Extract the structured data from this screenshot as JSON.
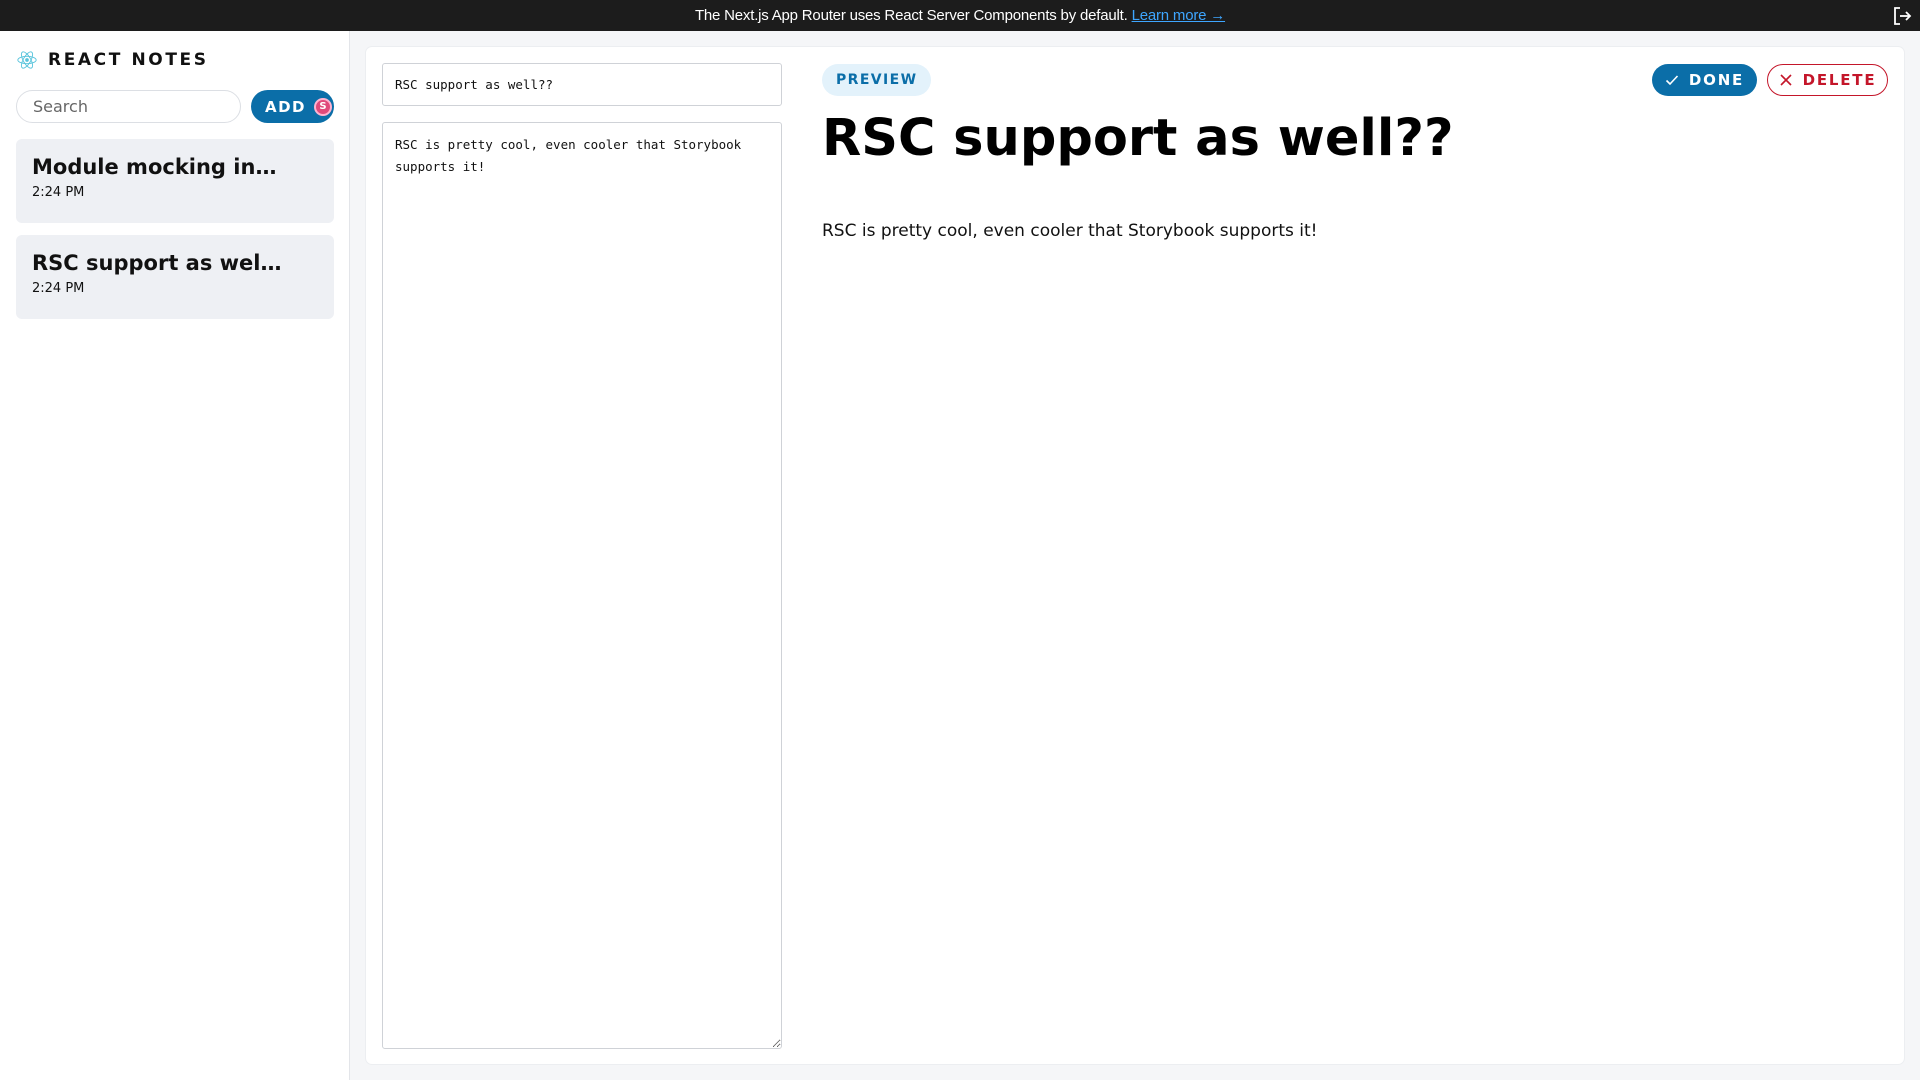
{
  "banner": {
    "text": "The Next.js App Router uses React Server Components by default.",
    "link": "Learn more →"
  },
  "sidebar": {
    "brand": "REACT NOTES",
    "search_placeholder": "Search",
    "add_label": "ADD",
    "add_badge": "S",
    "notes": [
      {
        "title": "Module mocking in Storybook?",
        "time": "2:24 PM"
      },
      {
        "title": "RSC support as well??",
        "time": "2:24 PM"
      }
    ]
  },
  "editor": {
    "title_value": "RSC support as well??",
    "body_value": "RSC is pretty cool, even cooler that Storybook supports it!"
  },
  "preview": {
    "label": "PREVIEW",
    "title": "RSC support as well??",
    "body": "RSC is pretty cool, even cooler that Storybook supports it!"
  },
  "actions": {
    "done": "DONE",
    "delete": "DELETE"
  },
  "colors": {
    "accent": "#0b6ea8",
    "danger": "#c4162a",
    "banner_bg": "#1c1c1c"
  }
}
